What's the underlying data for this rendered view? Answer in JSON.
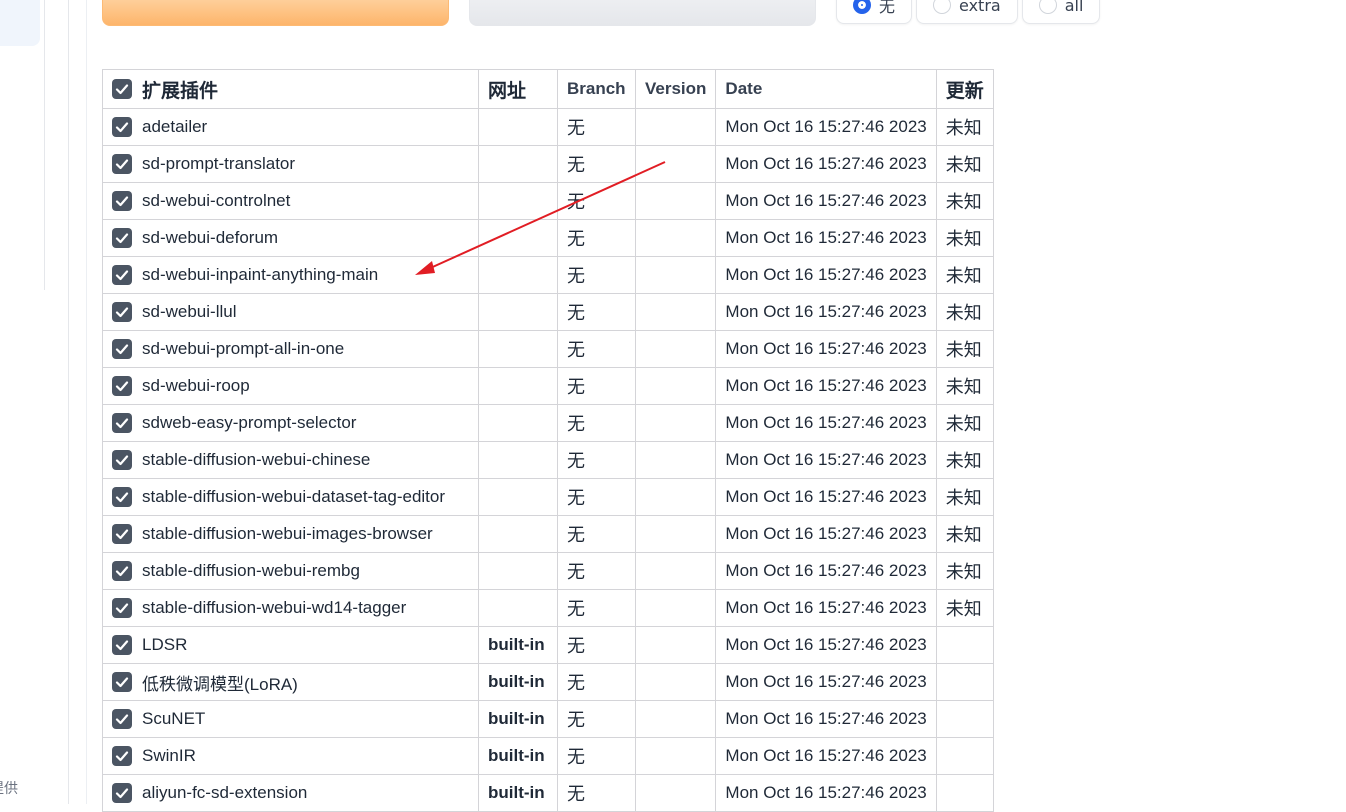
{
  "sidebar": {
    "footer_fragment": "提供"
  },
  "filter": {
    "options": [
      {
        "label": "无",
        "checked": true
      },
      {
        "label": "extra",
        "checked": false
      },
      {
        "label": "all",
        "checked": false
      }
    ]
  },
  "table": {
    "headers": {
      "name": "扩展插件",
      "url": "网址",
      "branch": "Branch",
      "version": "Version",
      "date": "Date",
      "update": "更新"
    },
    "rows": [
      {
        "name": "adetailer",
        "url": "",
        "branch": "无",
        "version": "",
        "date": "Mon Oct 16 15:27:46 2023",
        "update": "未知"
      },
      {
        "name": "sd-prompt-translator",
        "url": "",
        "branch": "无",
        "version": "",
        "date": "Mon Oct 16 15:27:46 2023",
        "update": "未知"
      },
      {
        "name": "sd-webui-controlnet",
        "url": "",
        "branch": "无",
        "version": "",
        "date": "Mon Oct 16 15:27:46 2023",
        "update": "未知"
      },
      {
        "name": "sd-webui-deforum",
        "url": "",
        "branch": "无",
        "version": "",
        "date": "Mon Oct 16 15:27:46 2023",
        "update": "未知"
      },
      {
        "name": "sd-webui-inpaint-anything-main",
        "url": "",
        "branch": "无",
        "version": "",
        "date": "Mon Oct 16 15:27:46 2023",
        "update": "未知"
      },
      {
        "name": "sd-webui-llul",
        "url": "",
        "branch": "无",
        "version": "",
        "date": "Mon Oct 16 15:27:46 2023",
        "update": "未知"
      },
      {
        "name": "sd-webui-prompt-all-in-one",
        "url": "",
        "branch": "无",
        "version": "",
        "date": "Mon Oct 16 15:27:46 2023",
        "update": "未知"
      },
      {
        "name": "sd-webui-roop",
        "url": "",
        "branch": "无",
        "version": "",
        "date": "Mon Oct 16 15:27:46 2023",
        "update": "未知"
      },
      {
        "name": "sdweb-easy-prompt-selector",
        "url": "",
        "branch": "无",
        "version": "",
        "date": "Mon Oct 16 15:27:46 2023",
        "update": "未知"
      },
      {
        "name": "stable-diffusion-webui-chinese",
        "url": "",
        "branch": "无",
        "version": "",
        "date": "Mon Oct 16 15:27:46 2023",
        "update": "未知"
      },
      {
        "name": "stable-diffusion-webui-dataset-tag-editor",
        "url": "",
        "branch": "无",
        "version": "",
        "date": "Mon Oct 16 15:27:46 2023",
        "update": "未知"
      },
      {
        "name": "stable-diffusion-webui-images-browser",
        "url": "",
        "branch": "无",
        "version": "",
        "date": "Mon Oct 16 15:27:46 2023",
        "update": "未知"
      },
      {
        "name": "stable-diffusion-webui-rembg",
        "url": "",
        "branch": "无",
        "version": "",
        "date": "Mon Oct 16 15:27:46 2023",
        "update": "未知"
      },
      {
        "name": "stable-diffusion-webui-wd14-tagger",
        "url": "",
        "branch": "无",
        "version": "",
        "date": "Mon Oct 16 15:27:46 2023",
        "update": "未知"
      },
      {
        "name": "LDSR",
        "url": "built-in",
        "branch": "无",
        "version": "",
        "date": "Mon Oct 16 15:27:46 2023",
        "update": ""
      },
      {
        "name": "低秩微调模型(LoRA)",
        "url": "built-in",
        "branch": "无",
        "version": "",
        "date": "Mon Oct 16 15:27:46 2023",
        "update": ""
      },
      {
        "name": "ScuNET",
        "url": "built-in",
        "branch": "无",
        "version": "",
        "date": "Mon Oct 16 15:27:46 2023",
        "update": ""
      },
      {
        "name": "SwinIR",
        "url": "built-in",
        "branch": "无",
        "version": "",
        "date": "Mon Oct 16 15:27:46 2023",
        "update": ""
      },
      {
        "name": "aliyun-fc-sd-extension",
        "url": "built-in",
        "branch": "无",
        "version": "",
        "date": "Mon Oct 16 15:27:46 2023",
        "update": ""
      }
    ]
  },
  "colors": {
    "checkbox": "#4b5563",
    "radio_selected": "#2563eb",
    "annotation_arrow": "#e11d24",
    "orange_button": "#fdb56b"
  }
}
